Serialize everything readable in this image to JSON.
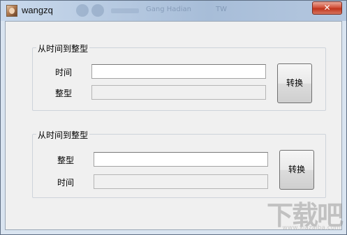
{
  "window": {
    "title": "wangzq",
    "close_label": "✕",
    "background_titles": [
      "Gang Hadian",
      "TW"
    ]
  },
  "group1": {
    "title": "从时间到整型",
    "time_label": "时间",
    "int_label": "整型",
    "time_value": "",
    "int_value": "",
    "convert_label": "转换"
  },
  "group2": {
    "title": "从时间到整型",
    "int_label": "整型",
    "time_label": "时间",
    "int_value": "",
    "time_value": "",
    "convert_label": "转换"
  },
  "watermark": {
    "main": "下载吧",
    "url": "www.xiazaiba.com"
  }
}
